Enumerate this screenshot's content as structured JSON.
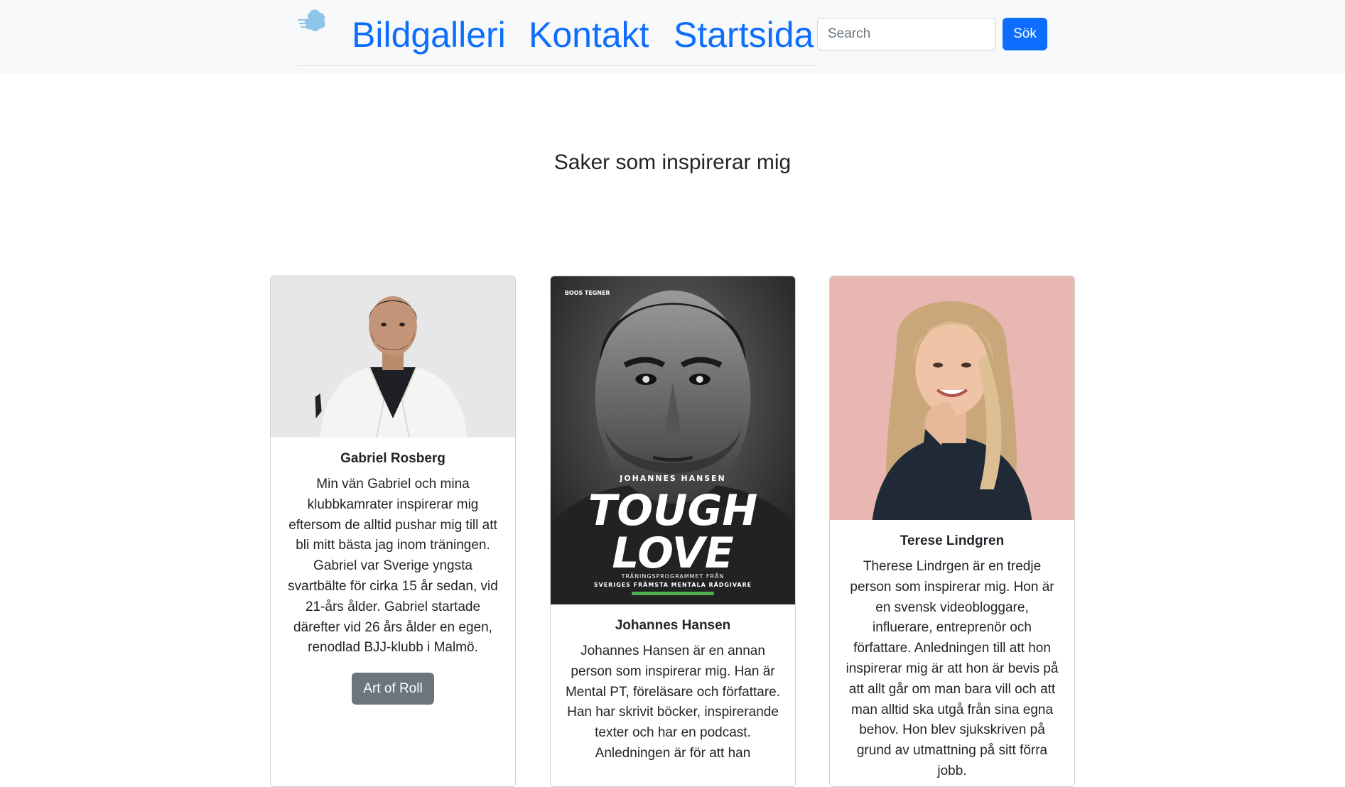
{
  "nav": {
    "brand_icon": "cloud-wind-icon",
    "links": [
      {
        "label": "Bildgalleri"
      },
      {
        "label": "Kontakt"
      },
      {
        "label": "Startsida"
      }
    ],
    "search": {
      "placeholder": "Search",
      "button_label": "Sök"
    }
  },
  "main": {
    "title": "Saker som inspirerar mig"
  },
  "cards": [
    {
      "title": "Gabriel Rosberg",
      "text": "Min vän Gabriel och mina klubbkamrater inspirerar mig eftersom de alltid pushar mig till att bli mitt bästa jag inom träningen. Gabriel var Sverige yngsta svartbälte för cirka 15 år sedan, vid 21-års ålder. Gabriel startade därefter vid 26 års ålder en egen, renodlad BJJ-klubb i Malmö.",
      "button_label": "Art of Roll"
    },
    {
      "title": "Johannes Hansen",
      "text": "Johannes Hansen är en annan person som inspirerar mig. Han är Mental PT, föreläsare och författare. Han har skrivit böcker, inspirerande texter och har en podcast. Anledningen är för att han",
      "image_text": {
        "publisher": "BOOS TEGNER",
        "author": "JOHANNES HANSEN",
        "title_line1": "TOUGH",
        "title_line2": "LOVE",
        "subtitle_line1": "TRÄNINGSPROGRAMMET FRÅN",
        "subtitle_line2": "SVERIGES FRÄMSTA MENTALA RÅDGIVARE"
      }
    },
    {
      "title": "Terese Lindgren",
      "text": "Therese Lindrgen är en tredje person som inspirerar mig. Hon är en svensk videobloggare, influerare, entreprenör och författare. Anledningen till att hon inspirerar mig är att hon är bevis på att allt går om man bara vill och att man alltid ska utgå från sina egna behov. Hon blev sjukskriven på grund av utmattning på sitt förra jobb."
    }
  ],
  "colors": {
    "primary": "#0d6efd",
    "secondary": "#6c757d",
    "navbar_bg": "#f8f9fa"
  }
}
